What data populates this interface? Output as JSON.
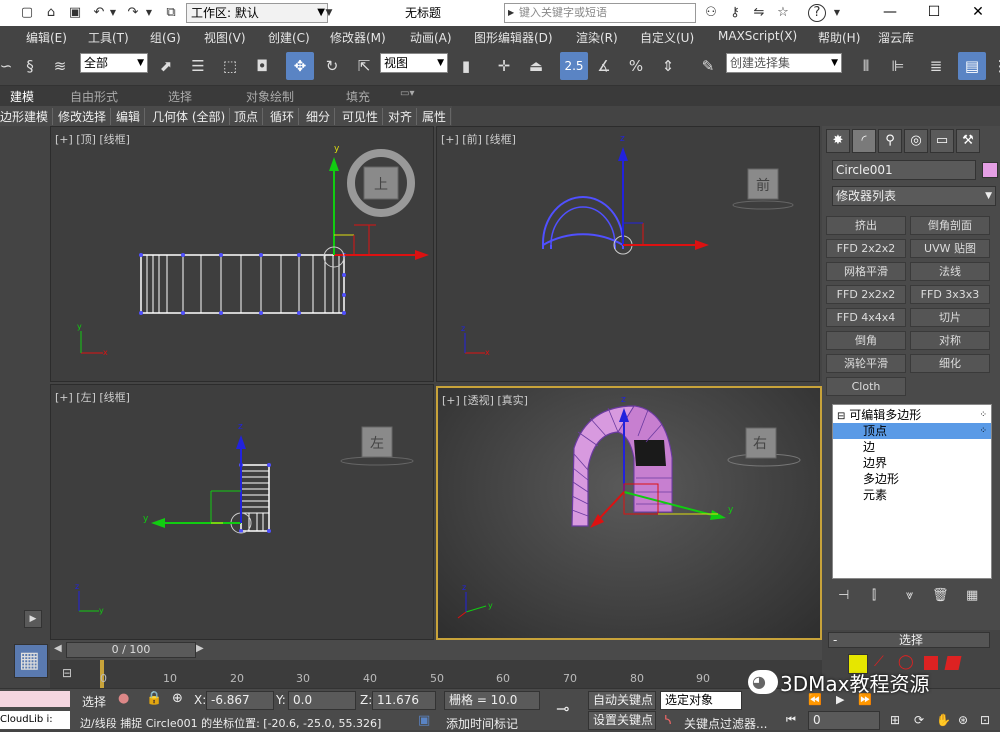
{
  "titlebar": {
    "workspace_label": "工作区: 默认",
    "window_title": "无标题",
    "search_placeholder": "键入关键字或短语"
  },
  "menubar": {
    "items": [
      "编辑(E)",
      "工具(T)",
      "组(G)",
      "视图(V)",
      "创建(C)",
      "修改器(M)",
      "动画(A)",
      "图形编辑器(D)",
      "渲染(R)",
      "自定义(U)",
      "MAXScript(X)",
      "帮助(H)",
      "溜云库"
    ]
  },
  "toolbar": {
    "filter_value": "全部",
    "refcoord_value": "视图",
    "snap_value": "2.5",
    "named_sel_value": "创建选择集"
  },
  "ribbon": {
    "tabs": [
      "建模",
      "自由形式",
      "选择",
      "对象绘制",
      "填充"
    ],
    "panel_items": [
      "边形建模",
      "修改选择",
      "编辑",
      "几何体 (全部)",
      "顶点",
      "循环",
      "细分",
      "可见性",
      "对齐",
      "属性"
    ]
  },
  "viewports": {
    "top": {
      "label": "[+] [顶] [线框]",
      "cube_label": "上"
    },
    "front": {
      "label": "[+] [前] [线框]",
      "cube_label": "前"
    },
    "left": {
      "label": "[+] [左] [线框]",
      "cube_label": "左"
    },
    "persp": {
      "label": "[+] [透视] [真实]",
      "cube_label": "右"
    }
  },
  "cmdpanel": {
    "object_name": "Circle001",
    "object_color": "#e6a0e6",
    "modifier_list": "修改器列表",
    "modifier_buttons": [
      "挤出",
      "倒角剖面",
      "FFD 2x2x2",
      "UVW 贴图",
      "网格平滑",
      "法线",
      "FFD 2x2x2",
      "FFD 3x3x3",
      "FFD 4x4x4",
      "切片",
      "倒角",
      "对称",
      "涡轮平滑",
      "细化",
      "Cloth"
    ],
    "stack": {
      "root": "可编辑多边形",
      "items": [
        "顶点",
        "边",
        "边界",
        "多边形",
        "元素"
      ],
      "selected": 0
    },
    "rollout_title": "选择"
  },
  "timeline": {
    "position": "0 / 100",
    "ticks": [
      "0",
      "10",
      "20",
      "30",
      "40",
      "50",
      "60",
      "70",
      "80",
      "90"
    ]
  },
  "status": {
    "select_label": "选择",
    "x_label": "X:",
    "x": "-6.867",
    "y_label": "Y:",
    "y": "0.0",
    "z_label": "Z:",
    "z": "11.676",
    "grid": "栅格 = 10.0",
    "autokey": "自动关键点",
    "setkey": "设置关键点",
    "selected_obj": "选定对象",
    "add_time_tag": "添加时间标记",
    "key_filter": "关键点过滤器...",
    "frame": "0",
    "prompt": "边/线段 捕捉 Circle001 的坐标位置: [-20.6, -25.0, 55.326]",
    "script_prefix": "CloudLib i:"
  },
  "watermark": "3DMax教程资源"
}
